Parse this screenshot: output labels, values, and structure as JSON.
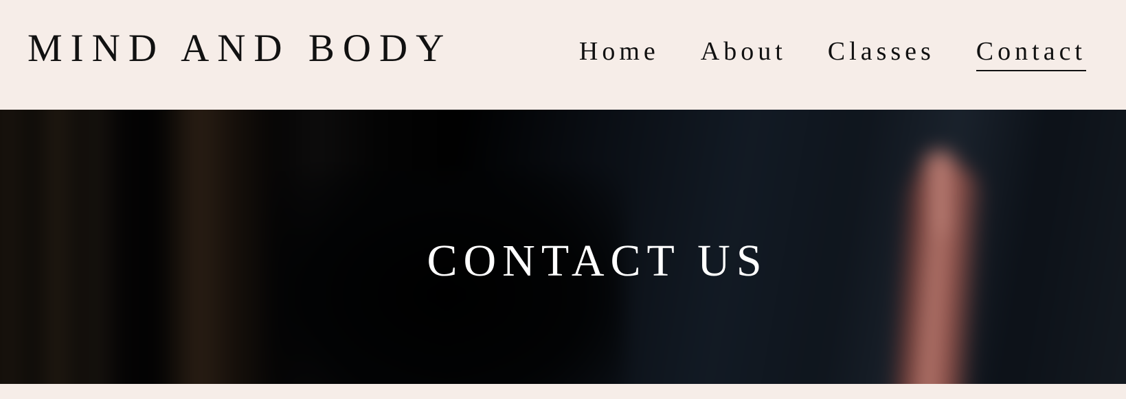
{
  "brand": {
    "name": "MIND AND BODY"
  },
  "nav": {
    "items": [
      {
        "label": "Home",
        "active": false
      },
      {
        "label": "About",
        "active": false
      },
      {
        "label": "Classes",
        "active": false
      },
      {
        "label": "Contact",
        "active": true
      }
    ]
  },
  "hero": {
    "title": "CONTACT US",
    "image_description_icon": "blurred-yoga-hero-image"
  },
  "colors": {
    "page_background": "#f6ede8",
    "text_dark": "#111111",
    "hero_text": "#ffffff"
  }
}
